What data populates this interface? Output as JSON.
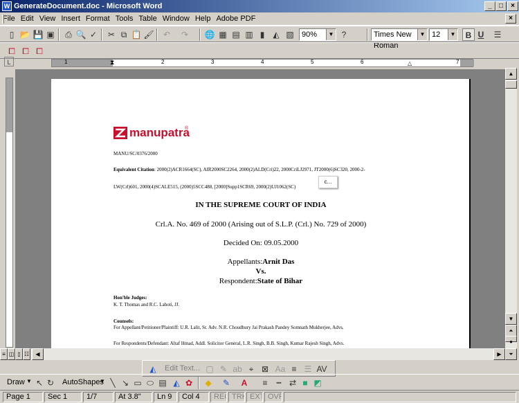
{
  "window": {
    "title": "GenerateDocument.doc - Microsoft Word"
  },
  "menu": [
    "File",
    "Edit",
    "View",
    "Insert",
    "Format",
    "Tools",
    "Table",
    "Window",
    "Help",
    "Adobe PDF"
  ],
  "toolbar": {
    "zoom": "90%",
    "font": "Times New Roman",
    "size": "12",
    "bold": "B",
    "underline": "U"
  },
  "ruler": {
    "numbers": [
      "1",
      "2",
      "3",
      "4",
      "5",
      "6",
      "7"
    ]
  },
  "document": {
    "logo_text": "manupatra",
    "citation_id": "MANU/SC/0376/2000",
    "eq_label": "Equivalent Citation",
    "eq_line1": ": 2000(2)ACR1664(SC), AIR2000SC2264, 2000(2)ALD(Cri)22, 2000CriLJ2971, JT2000(6)SC320, 2000-2-",
    "eq_line2": "LW(Crl)601, 2000(4)SCALE515, (2000)5SCC488, [2000]Supp1SCR69, 2000(2)UJ1062(SC)",
    "tooltip": "c...",
    "court": "IN THE SUPREME COURT OF INDIA",
    "case_no": "Crl.A. No. 469 of 2000 (Arising out of S.L.P. (Crl.) No. 729 of 2000)",
    "decided": "Decided On: 09.05.2000",
    "appellants_label": "Appellants:",
    "appellants_name": "Arnit Das",
    "vs": "Vs.",
    "respondent_label": "Respondent:",
    "respondent_name": "State of Bihar",
    "judges_label": "Hon'ble Judges:",
    "judges": "K. T. Thomas and R.C. Lahoti, JJ.",
    "counsels_label": "Counsels:",
    "counsel_appellant": "For Appellant/Petitioner/Plaintiff: U.R. Lalit, Sr. Adv. N.R. Choudhury Jai Prakash Pandey Somnath Mukherjee, Advs.",
    "counsel_respondent": "For Respondents/Defendant: Altaf Hmad, Addl. Solicitor General, L.R. Singh, B.B. Singh, Kumar Rajesh Singh, Advs."
  },
  "drawing": {
    "draw": "Draw",
    "autoshapes": "AutoShapes",
    "edit_text": "Edit Text..."
  },
  "status": {
    "page": "Page 1",
    "sec": "Sec 1",
    "pages": "1/7",
    "at": "At 3.8\"",
    "ln": "Ln 9",
    "col": "Col 4",
    "rec": "REC",
    "trk": "TRK",
    "ext": "EXT",
    "ovr": "OVR"
  },
  "colors": {
    "titlebar_start": "#0a246a",
    "titlebar_end": "#a6caf0",
    "logo_red": "#c8102e"
  }
}
